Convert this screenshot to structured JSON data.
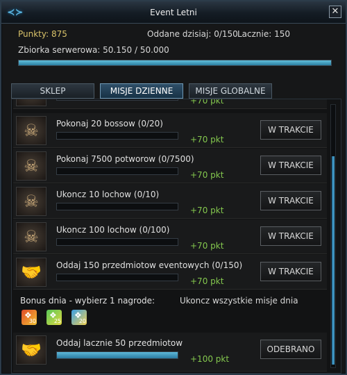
{
  "window": {
    "title": "Event Letni",
    "logo_icon": "ornament-logo-icon",
    "close_symbol": "✕"
  },
  "info": {
    "points": "Punkty: 875",
    "given_today": "Oddane dzisiaj: 0/150",
    "total": "Lacznie: 150",
    "server_collection": "Zbiorka serwerowa: 50.150 / 50.000",
    "server_progress_fraction": 1.0
  },
  "tabs": [
    {
      "label": "SKLEP",
      "active": false
    },
    {
      "label": "MISJE DZIENNE",
      "active": true
    },
    {
      "label": "MISJE GLOBALNE",
      "active": false
    }
  ],
  "missions": [
    {
      "name": "",
      "progress_fraction": 0,
      "reward": "+70 pkt",
      "status": "",
      "icon": "skull-icon"
    },
    {
      "name": "Pokonaj 20 bossow (0/20)",
      "progress_fraction": 0,
      "reward": "+70 pkt",
      "status": "W TRAKCIE",
      "icon": "skull-icon"
    },
    {
      "name": "Pokonaj 7500 potworow (0/7500)",
      "progress_fraction": 0,
      "reward": "+70 pkt",
      "status": "W TRAKCIE",
      "icon": "skull-icon"
    },
    {
      "name": "Ukoncz 10 lochow (0/10)",
      "progress_fraction": 0,
      "reward": "+70 pkt",
      "status": "W TRAKCIE",
      "icon": "skull-icon"
    },
    {
      "name": "Ukoncz 100 lochow (0/100)",
      "progress_fraction": 0,
      "reward": "+70 pkt",
      "status": "W TRAKCIE",
      "icon": "skull-icon"
    },
    {
      "name": "Oddaj 150 przedmiotow eventowych (0/150)",
      "progress_fraction": 0,
      "reward": "+70 pkt",
      "status": "W TRAKCIE",
      "icon": "handshake-icon"
    }
  ],
  "bonus": {
    "label": "Bonus dnia - wybierz 1 nagrode:",
    "hint": "Ukoncz wszystkie misje dnia",
    "gifts": [
      {
        "icon": "gift-chest-icon",
        "count": "30"
      },
      {
        "icon": "gift-chest-icon",
        "count": "25"
      },
      {
        "icon": "gift-chest-icon",
        "count": "20"
      }
    ]
  },
  "final_mission": {
    "name": "Oddaj lacznie 50 przedmiotow",
    "progress_fraction": 1.0,
    "reward": "+100 pkt",
    "status": "ODEBRANO",
    "icon": "handshake-icon"
  }
}
